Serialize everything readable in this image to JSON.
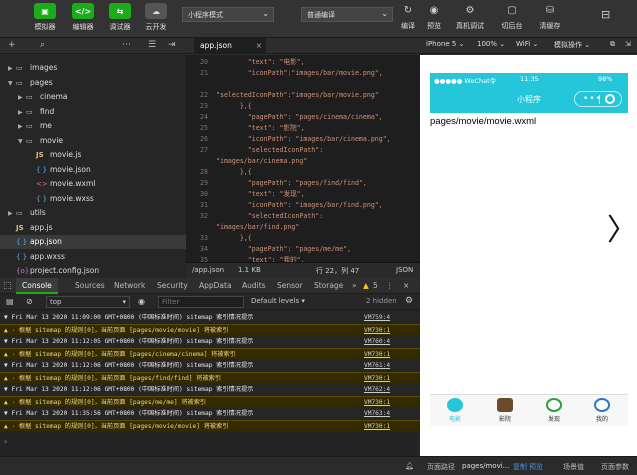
{
  "toolbar": {
    "buttons": [
      {
        "icon": "avatar-icon",
        "label": "模拟器"
      },
      {
        "icon": "code-icon",
        "label": "编辑器"
      },
      {
        "icon": "debug-icon",
        "label": "调试器"
      },
      {
        "icon": "cloud-icon",
        "label": "云开发"
      }
    ],
    "mode_select": "小程序模式",
    "compile_select": "普通编译",
    "right_buttons": [
      {
        "icon": "refresh-icon",
        "label": "编译"
      },
      {
        "icon": "eye-icon",
        "label": "预览"
      },
      {
        "icon": "phone-debug-icon",
        "label": "真机调试"
      },
      {
        "icon": "backend-icon",
        "label": "切后台"
      },
      {
        "icon": "clear-cache-icon",
        "label": "清缓存"
      }
    ],
    "accent_color": "#1aad19"
  },
  "explorer": {
    "items": [
      {
        "depth": 0,
        "arrow": "▶",
        "icon": "folder-icon",
        "name": "images",
        "type": "folder"
      },
      {
        "depth": 0,
        "arrow": "▼",
        "icon": "folder-open-icon",
        "name": "pages",
        "type": "folder"
      },
      {
        "depth": 1,
        "arrow": "▶",
        "icon": "folder-icon",
        "name": "cinema",
        "type": "folder"
      },
      {
        "depth": 1,
        "arrow": "▶",
        "icon": "folder-icon",
        "name": "find",
        "type": "folder"
      },
      {
        "depth": 1,
        "arrow": "▶",
        "icon": "folder-icon",
        "name": "me",
        "type": "folder"
      },
      {
        "depth": 1,
        "arrow": "▼",
        "icon": "folder-open-icon",
        "name": "movie",
        "type": "folder"
      },
      {
        "depth": 2,
        "arrow": "",
        "icon": "js-file-icon",
        "name": "movie.js",
        "type": "js"
      },
      {
        "depth": 2,
        "arrow": "",
        "icon": "json-file-icon",
        "name": "movie.json",
        "type": "json"
      },
      {
        "depth": 2,
        "arrow": "",
        "icon": "wxml-file-icon",
        "name": "movie.wxml",
        "type": "wxml"
      },
      {
        "depth": 2,
        "arrow": "",
        "icon": "wxss-file-icon",
        "name": "movie.wxss",
        "type": "wxss"
      },
      {
        "depth": 0,
        "arrow": "▶",
        "icon": "folder-icon",
        "name": "utils",
        "type": "folder"
      },
      {
        "depth": 0,
        "arrow": "",
        "icon": "js-file-icon",
        "name": "app.js",
        "type": "js"
      },
      {
        "depth": 0,
        "arrow": "",
        "icon": "json-file-icon",
        "name": "app.json",
        "type": "json",
        "selected": true
      },
      {
        "depth": 0,
        "arrow": "",
        "icon": "wxss-file-icon",
        "name": "app.wxss",
        "type": "wxss"
      },
      {
        "depth": 0,
        "arrow": "",
        "icon": "config-file-icon",
        "name": "project.config.json",
        "type": "cfg"
      }
    ]
  },
  "editor": {
    "tab_label": "app.json",
    "lines": [
      {
        "n": "20",
        "text": "        \"text\": \"电影\","
      },
      {
        "n": "21",
        "text": "        \"iconPath\":\"images/bar/movie.png\","
      },
      {
        "n": "",
        "text": ""
      },
      {
        "n": "22",
        "text": "\"selectedIconPath\":\"images/bar/movie.png\""
      },
      {
        "n": "23",
        "text": "      },{"
      },
      {
        "n": "24",
        "text": "        \"pagePath\": \"pages/cinema/cinema\","
      },
      {
        "n": "25",
        "text": "        \"text\": \"影院\","
      },
      {
        "n": "26",
        "text": "        \"iconPath\": \"images/bar/cinema.png\","
      },
      {
        "n": "27",
        "text": "        \"selectedIconPath\":"
      },
      {
        "n": "",
        "text": "\"images/bar/cinema.png\""
      },
      {
        "n": "28",
        "text": "      },{"
      },
      {
        "n": "29",
        "text": "        \"pagePath\": \"pages/find/find\","
      },
      {
        "n": "30",
        "text": "        \"text\": \"发现\","
      },
      {
        "n": "31",
        "text": "        \"iconPath\": \"images/bar/find.png\","
      },
      {
        "n": "32",
        "text": "        \"selectedIconPath\":"
      },
      {
        "n": "",
        "text": "\"images/bar/find.png\""
      },
      {
        "n": "33",
        "text": "      },{"
      },
      {
        "n": "34",
        "text": "        \"pagePath\": \"pages/me/me\","
      },
      {
        "n": "35",
        "text": "        \"text\": \"我的\","
      }
    ],
    "status": {
      "path": "/app.json",
      "size": "1.1 KB",
      "position": "行 22，列 47",
      "lang": "JSON"
    }
  },
  "simulator": {
    "device": "iPhone 5",
    "zoom": "100%",
    "network": "WiFi",
    "operation": "模拟操作",
    "status_left": "●●●●● WeChat令",
    "time": "11:35",
    "battery": "98%",
    "nav_title": "小程序",
    "nav_color": "#26c6da",
    "page_path": "pages/movie/movie.wxml",
    "tabbar": [
      {
        "label": "电影",
        "icon": "movie-tab-icon",
        "active": true
      },
      {
        "label": "影院",
        "icon": "cinema-tab-icon"
      },
      {
        "label": "发现",
        "icon": "find-tab-icon"
      },
      {
        "label": "我的",
        "icon": "me-tab-icon"
      }
    ]
  },
  "console": {
    "tabs": [
      "Console",
      "Sources",
      "Network",
      "Security",
      "AppData",
      "Audits",
      "Sensor",
      "Storage"
    ],
    "more": "»",
    "warnings_count": "5",
    "context": "top",
    "filter_placeholder": "Filter",
    "levels": "Default levels ▾",
    "hidden": "2 hidden",
    "entries": [
      {
        "kind": "grp",
        "text": "▼ Fri Mar 13 2020 11:09:00 GMT+0800 (中国标准时间) sitemap 索引情况提示",
        "src": "VM759:4"
      },
      {
        "kind": "warn",
        "text": "  ▲ · 根据 sitemap 的规则[0]，当前页面 [pages/movie/movie] 将被索引",
        "src": "VM730:1"
      },
      {
        "kind": "grp",
        "text": "▼ Fri Mar 13 2020 11:12:05 GMT+0800 (中国标准时间) sitemap 索引情况提示",
        "src": "VM760:4"
      },
      {
        "kind": "warn",
        "text": "  ▲ · 根据 sitemap 的规则[0]，当前页面 [pages/cinema/cinema] 将被索引",
        "src": "VM730:1"
      },
      {
        "kind": "grp",
        "text": "▼ Fri Mar 13 2020 11:12:06 GMT+0800 (中国标准时间) sitemap 索引情况提示",
        "src": "VM761:4"
      },
      {
        "kind": "warn",
        "text": "  ▲ · 根据 sitemap 的规则[0]，当前页面 [pages/find/find] 将被索引",
        "src": "VM730:1"
      },
      {
        "kind": "grp",
        "text": "▼ Fri Mar 13 2020 11:12:06 GMT+0800 (中国标准时间) sitemap 索引情况提示",
        "src": "VM762:4"
      },
      {
        "kind": "warn",
        "text": "  ▲ · 根据 sitemap 的规则[0]，当前页面 [pages/me/me] 将被索引",
        "src": "VM730:1"
      },
      {
        "kind": "grp",
        "text": "▼ Fri Mar 13 2020 11:35:56 GMT+0800 (中国标准时间) sitemap 索引情况提示",
        "src": "VM763:4"
      },
      {
        "kind": "warn",
        "text": "  ▲ · 根据 sitemap 的规则[0]，当前页面 [pages/movie/movie] 将被索引",
        "src": "VM730:1"
      }
    ],
    "prompt": "›"
  },
  "statusbar": {
    "page_path_label": "页面路径",
    "page_path": "pages/movi...",
    "copy": "复制",
    "preview": "预览",
    "scene": "场景值",
    "params": "页面参数"
  }
}
